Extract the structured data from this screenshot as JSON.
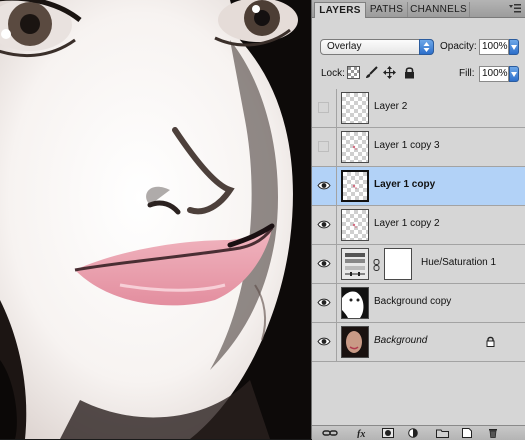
{
  "tabs": [
    {
      "label": "LAYERS",
      "active": true
    },
    {
      "label": "PATHS",
      "active": false
    },
    {
      "label": "CHANNELS",
      "active": false
    }
  ],
  "blend_mode": "Overlay",
  "opacity": {
    "label": "Opacity:",
    "value": "100%"
  },
  "lock": {
    "label": "Lock:",
    "icons": [
      "transparency-lock-icon",
      "brush-lock-icon",
      "move-lock-icon",
      "padlock-icon"
    ]
  },
  "fill": {
    "label": "Fill:",
    "value": "100%"
  },
  "layers": [
    {
      "name": "Layer 2",
      "visible": false,
      "selected": false
    },
    {
      "name": "Layer 1 copy 3",
      "visible": false,
      "selected": false
    },
    {
      "name": "Layer 1 copy",
      "visible": true,
      "selected": true
    },
    {
      "name": "Layer 1 copy 2",
      "visible": true,
      "selected": false
    },
    {
      "name": "Hue/Saturation 1",
      "visible": true,
      "selected": false,
      "type": "adjustment"
    },
    {
      "name": "Background copy",
      "visible": true,
      "selected": false
    },
    {
      "name": "Background",
      "visible": true,
      "selected": false,
      "locked": true
    }
  ],
  "footer_icons": [
    "link-layers-icon",
    "layer-style-icon",
    "add-mask-icon",
    "adjustment-layer-icon",
    "new-group-icon",
    "new-layer-icon",
    "trash-icon"
  ],
  "colors": {
    "selected_row": "#b2d2f7",
    "panel_bg": "#d6d6d6",
    "lip_pink": "#e79aa8"
  }
}
